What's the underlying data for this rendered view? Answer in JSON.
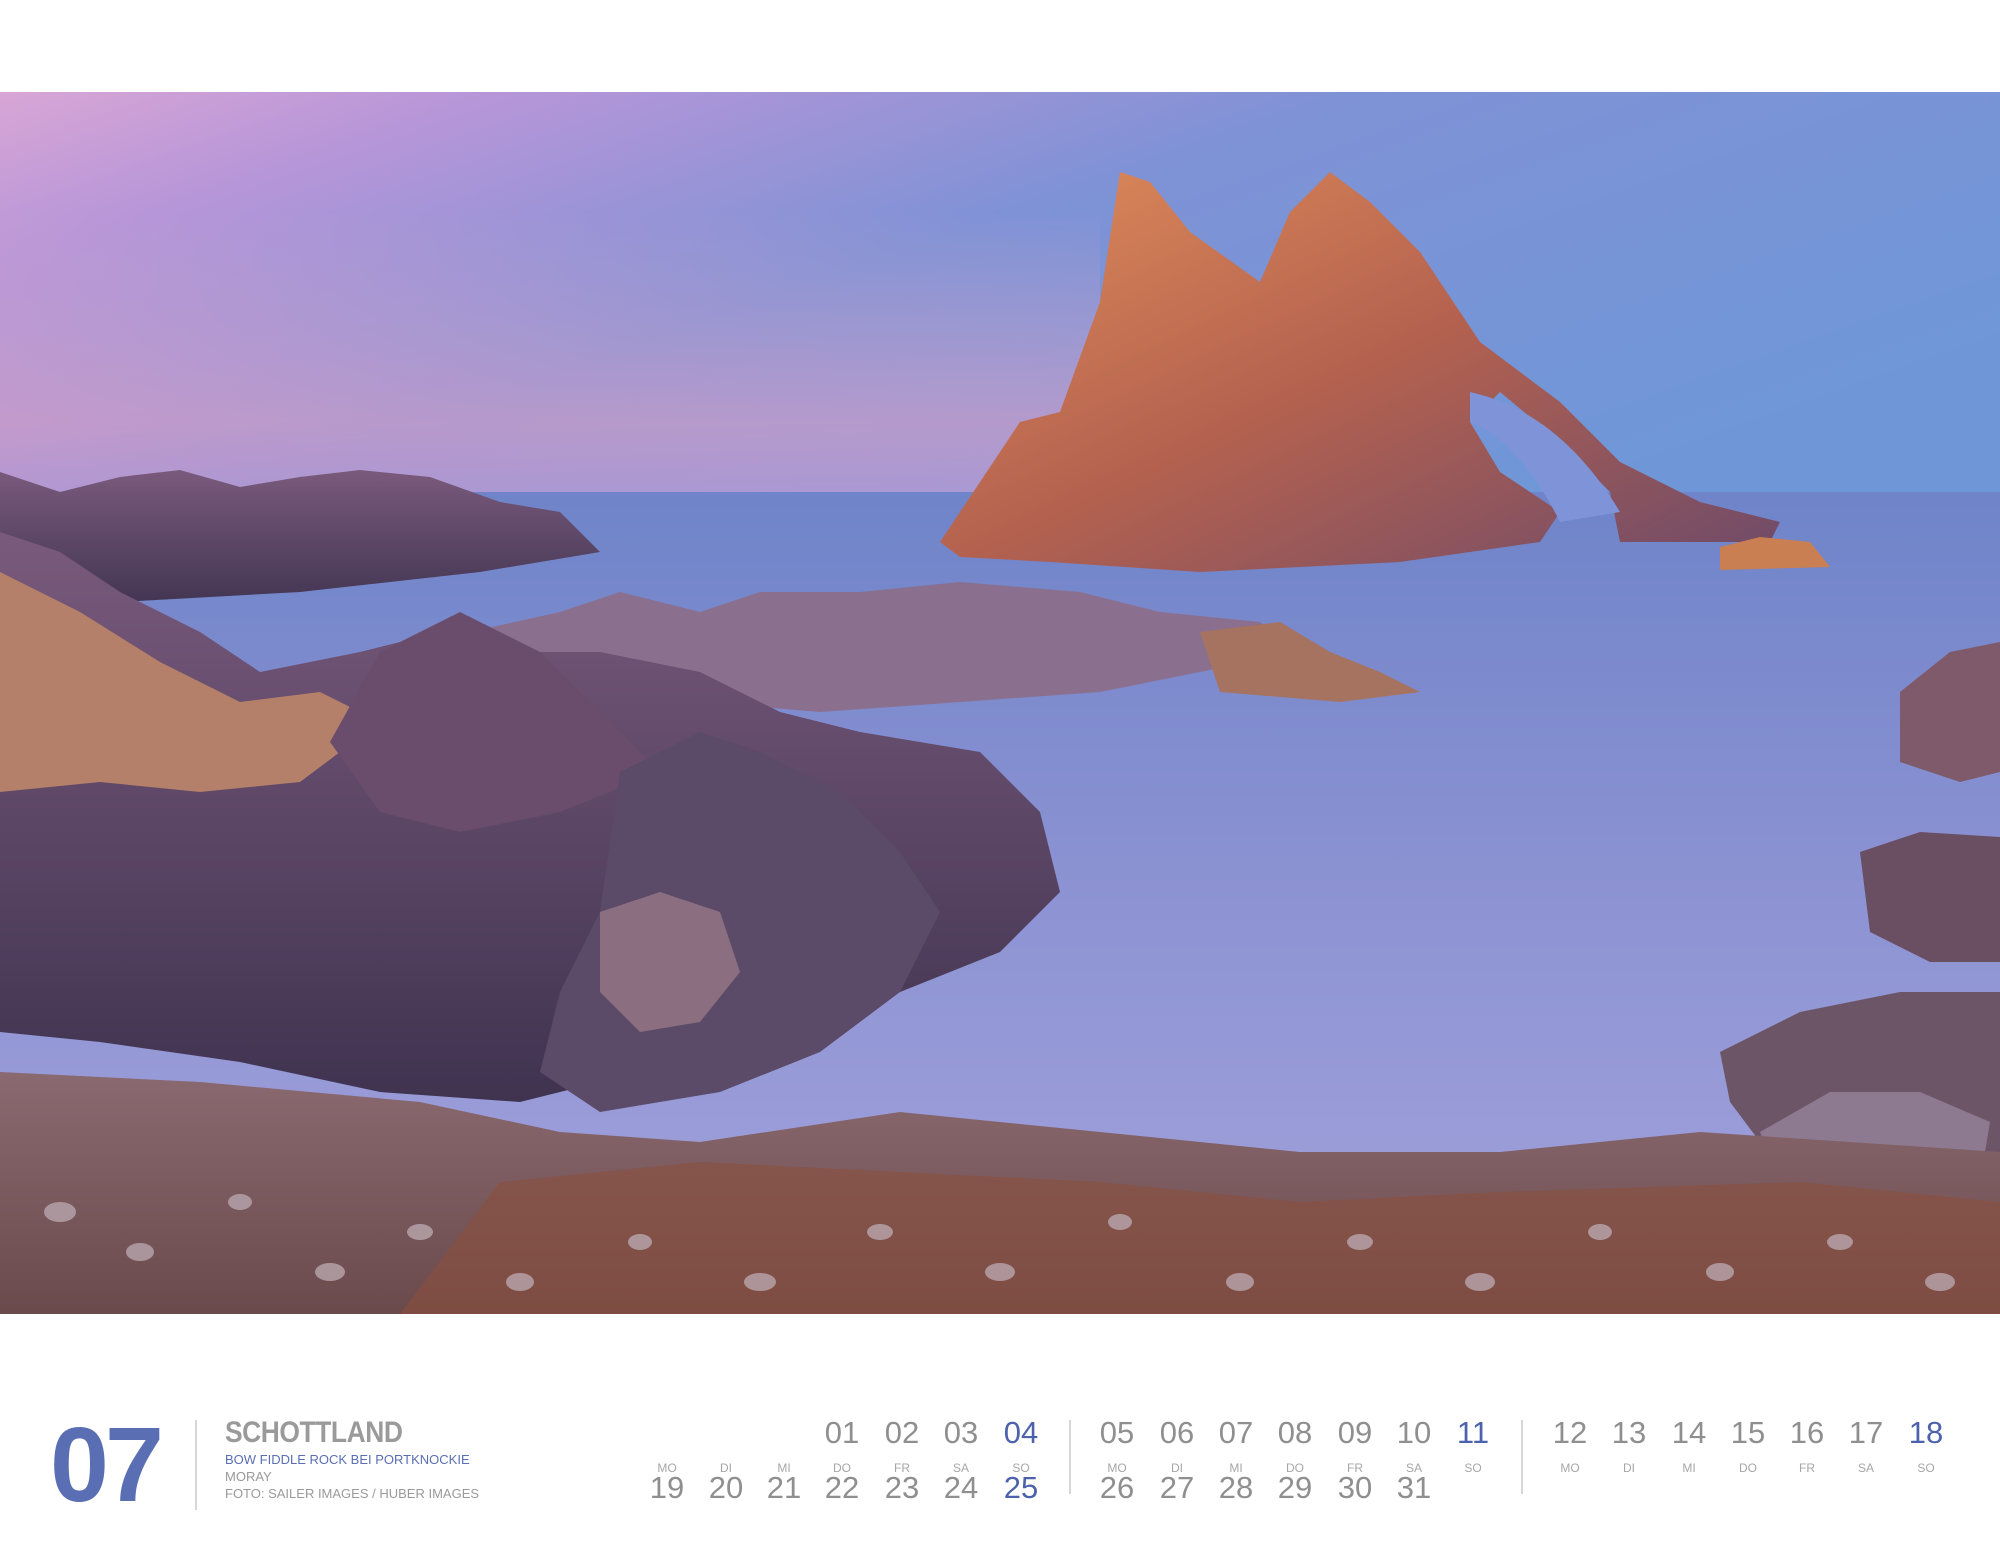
{
  "month": "07",
  "title": {
    "country": "SCHOTTLAND",
    "place": "BOW FIDDLE ROCK BEI PORTKNOCKIE",
    "region": "MORAY",
    "credit": "FOTO: SAILER IMAGES / HUBER IMAGES"
  },
  "photo": {
    "subject": "sea-arch-coast-photo"
  },
  "colors": {
    "accent": "#4d62ad",
    "text_gray": "#8f8f8f"
  },
  "weekday_labels": [
    "MO",
    "DI",
    "MI",
    "DO",
    "FR",
    "SA",
    "SO"
  ],
  "week1": {
    "top": [
      "01",
      "02",
      "03",
      "04"
    ],
    "top_weekdays": [
      "DO",
      "FR",
      "SA",
      "SO"
    ],
    "bottom": [
      "19",
      "20",
      "21",
      "22",
      "23",
      "24",
      "25"
    ],
    "bottom_weekdays": [
      "MO",
      "DI",
      "MI"
    ]
  },
  "week2": {
    "top": [
      "05",
      "06",
      "07",
      "08",
      "09",
      "10",
      "11"
    ],
    "top_weekdays": [
      "MO",
      "DI",
      "MI",
      "DO",
      "FR",
      "SA",
      "SO"
    ],
    "bottom": [
      "26",
      "27",
      "28",
      "29",
      "30",
      "31"
    ]
  },
  "week3": {
    "top": [
      "12",
      "13",
      "14",
      "15",
      "16",
      "17",
      "18"
    ],
    "top_weekdays": [
      "MO",
      "DI",
      "MI",
      "DO",
      "FR",
      "SA",
      "SO"
    ]
  }
}
